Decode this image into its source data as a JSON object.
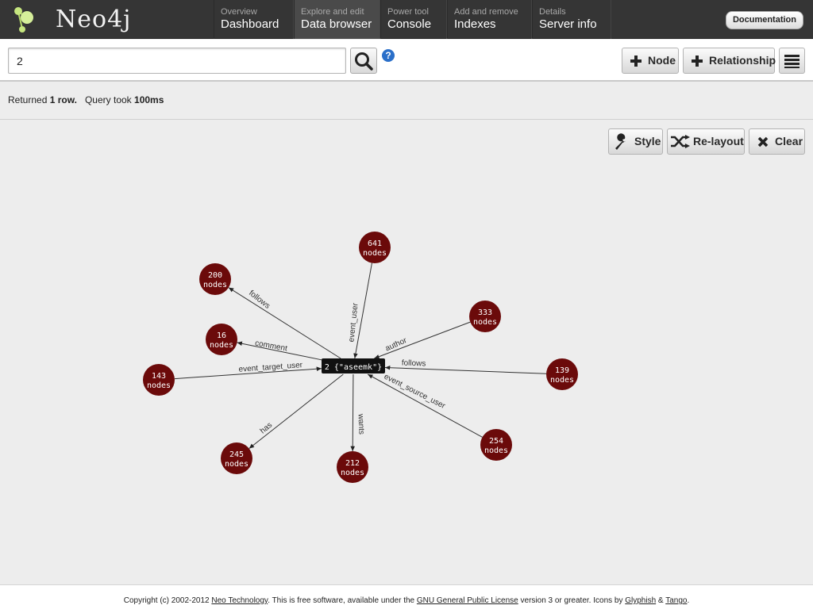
{
  "app": {
    "logo_text": "Neo4j"
  },
  "nav": {
    "tabs": [
      {
        "sub": "Overview",
        "main": "Dashboard"
      },
      {
        "sub": "Explore and edit",
        "main": "Data browser"
      },
      {
        "sub": "Power tool",
        "main": "Console"
      },
      {
        "sub": "Add and remove",
        "main": "Indexes"
      },
      {
        "sub": "Details",
        "main": "Server info"
      }
    ],
    "documentation_label": "Documentation"
  },
  "search": {
    "value": "2",
    "help_label": "?"
  },
  "toolbar": {
    "add_node_label": "Node",
    "add_relationship_label": "Relationship"
  },
  "result": {
    "returned_prefix": "Returned",
    "rows": "1 row.",
    "query_prefix": "Query took",
    "time": "100ms"
  },
  "graph_toolbar": {
    "style_label": "Style",
    "relayout_label": "Re-layout",
    "clear_label": "Clear"
  },
  "graph": {
    "center": {
      "label": "2 {\"aseemk\"}"
    },
    "groups": [
      {
        "count": "641",
        "unit": "nodes",
        "relation": "event_user",
        "direction": "in"
      },
      {
        "count": "200",
        "unit": "nodes",
        "relation": "follows",
        "direction": "out"
      },
      {
        "count": "333",
        "unit": "nodes",
        "relation": "author",
        "direction": "in"
      },
      {
        "count": "16",
        "unit": "nodes",
        "relation": "comment",
        "direction": "out"
      },
      {
        "count": "143",
        "unit": "nodes",
        "relation": "event_target_user",
        "direction": "in"
      },
      {
        "count": "139",
        "unit": "nodes",
        "relation": "follows",
        "direction": "in"
      },
      {
        "count": "254",
        "unit": "nodes",
        "relation": "event_source_user",
        "direction": "in"
      },
      {
        "count": "245",
        "unit": "nodes",
        "relation": "has",
        "direction": "out"
      },
      {
        "count": "212",
        "unit": "nodes",
        "relation": "wants",
        "direction": "out"
      }
    ],
    "node_color": "#6b0a0a"
  },
  "footer": {
    "text1": "Copyright (c) 2002-2012 ",
    "link1": "Neo Technology",
    "text2": ". This is free software, available under the ",
    "link2": "GNU General Public License",
    "text3": " version 3 or greater. Icons by ",
    "link3": "Glyphish",
    "text4": " & ",
    "link4": "Tango",
    "text5": "."
  }
}
